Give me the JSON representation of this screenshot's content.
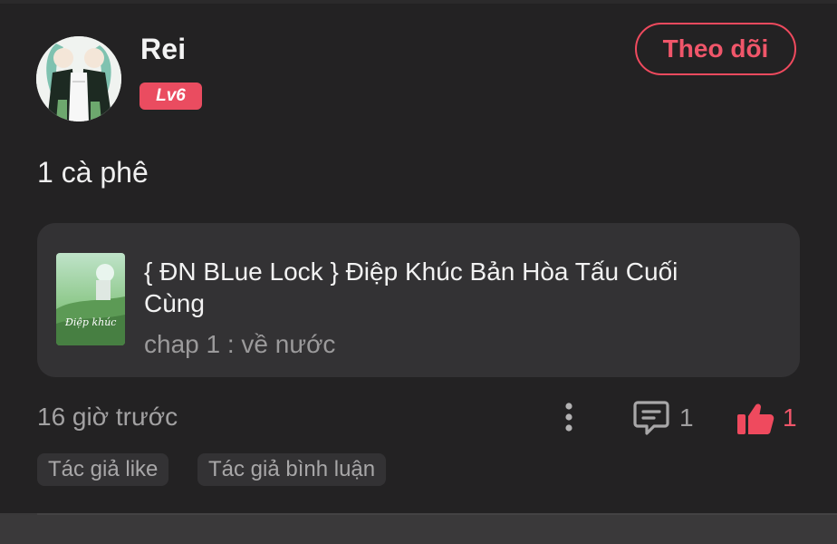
{
  "post": {
    "author": {
      "name": "Rei",
      "level": "Lv6"
    },
    "follow_label": "Theo dõi",
    "text": "1 cà phê",
    "story": {
      "title": "{ ĐN BLue Lock } Điệp Khúc Bản Hòa Tấu Cuối Cùng",
      "chapter": "chap 1 : về nước",
      "cover_text": "Điệp khúc"
    },
    "time": "16 giờ trước",
    "comment_count": "1",
    "like_count": "1",
    "tags": [
      "Tác giả like",
      "Tác giả bình luận"
    ]
  },
  "icons": {
    "more": "more-vertical-icon",
    "comment": "comment-icon",
    "like": "thumbs-up-icon"
  },
  "colors": {
    "background": "#232223",
    "accent": "#ef4a5e",
    "card": "#333234",
    "text_primary": "#f2f2f2",
    "text_secondary": "#9f9e9f"
  }
}
